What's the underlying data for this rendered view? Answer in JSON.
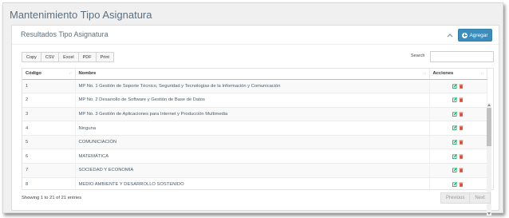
{
  "page": {
    "title": "Mantenimiento Tipo Asignatura"
  },
  "box": {
    "title": "Resultados Tipo Asignatura",
    "add_label": "Agregar",
    "accent": "#3c8dbc"
  },
  "toolbar": {
    "exports": [
      "Copy",
      "CSV",
      "Excel",
      "PDF",
      "Print"
    ],
    "search_label": "Search",
    "search_value": ""
  },
  "table": {
    "headers": {
      "code": "Código",
      "name": "Nombre",
      "actions": "Acciones"
    },
    "rows": [
      {
        "code": "1",
        "name": "MP No. 1 Gestión de Soporte Técnico, Seguridad y Tecnologías de la Información y Comunicación"
      },
      {
        "code": "2",
        "name": "MP No. 2 Desarrollo de Software y Gestión de Base de Datos"
      },
      {
        "code": "3",
        "name": "MP No. 3 Gestión de Aplicaciones para Internet y Producción Multimedia"
      },
      {
        "code": "4",
        "name": "Ninguna"
      },
      {
        "code": "5",
        "name": "COMUNICIACIÓN"
      },
      {
        "code": "6",
        "name": "MATEMÁTICA"
      },
      {
        "code": "7",
        "name": "SOCIEDAD Y ECONOMIA"
      },
      {
        "code": "8",
        "name": "MEDIO AMBIENTE Y DESARROLLO SOSTENIDO"
      }
    ],
    "edit_color": "#00a65a",
    "delete_color": "#dd4b39"
  },
  "footer": {
    "info": "Showing 1 to 21 of 21 entries",
    "previous": "Previous",
    "next": "Next"
  }
}
